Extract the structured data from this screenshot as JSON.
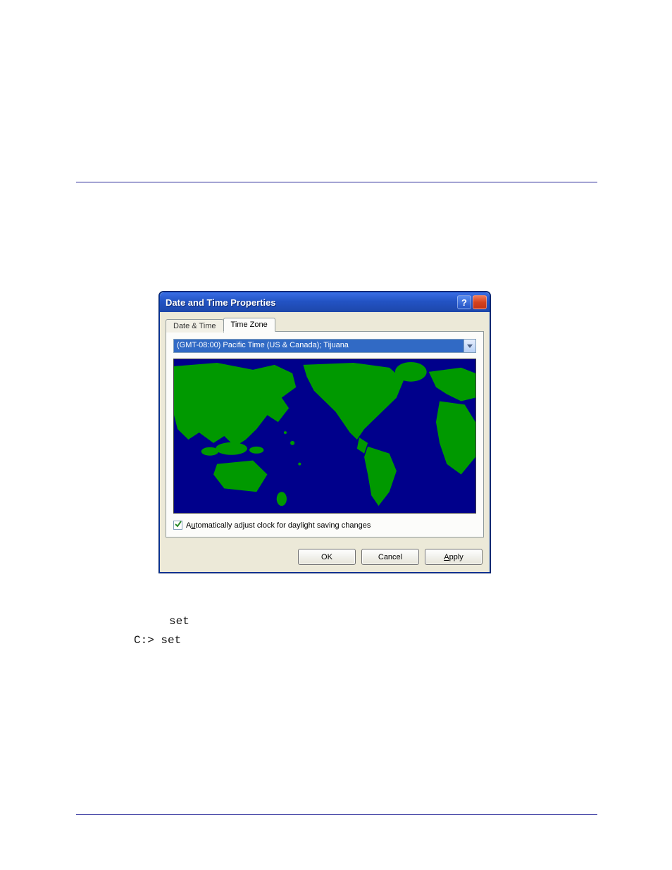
{
  "dialog": {
    "title": "Date and Time Properties",
    "tabs": [
      {
        "label": "Date & Time"
      },
      {
        "label": "Time Zone"
      }
    ],
    "timezone_selected": "(GMT-08:00) Pacific Time (US & Canada); Tijuana",
    "checkbox_label_pre": "A",
    "checkbox_label_under": "u",
    "checkbox_label_post": "tomatically adjust clock for daylight saving changes",
    "checkbox_checked": true,
    "buttons": {
      "ok": "OK",
      "cancel": "Cancel",
      "apply_pre": "",
      "apply_under": "A",
      "apply_post": "pply"
    }
  },
  "code": {
    "line1": "set",
    "line2": "C:> set"
  }
}
